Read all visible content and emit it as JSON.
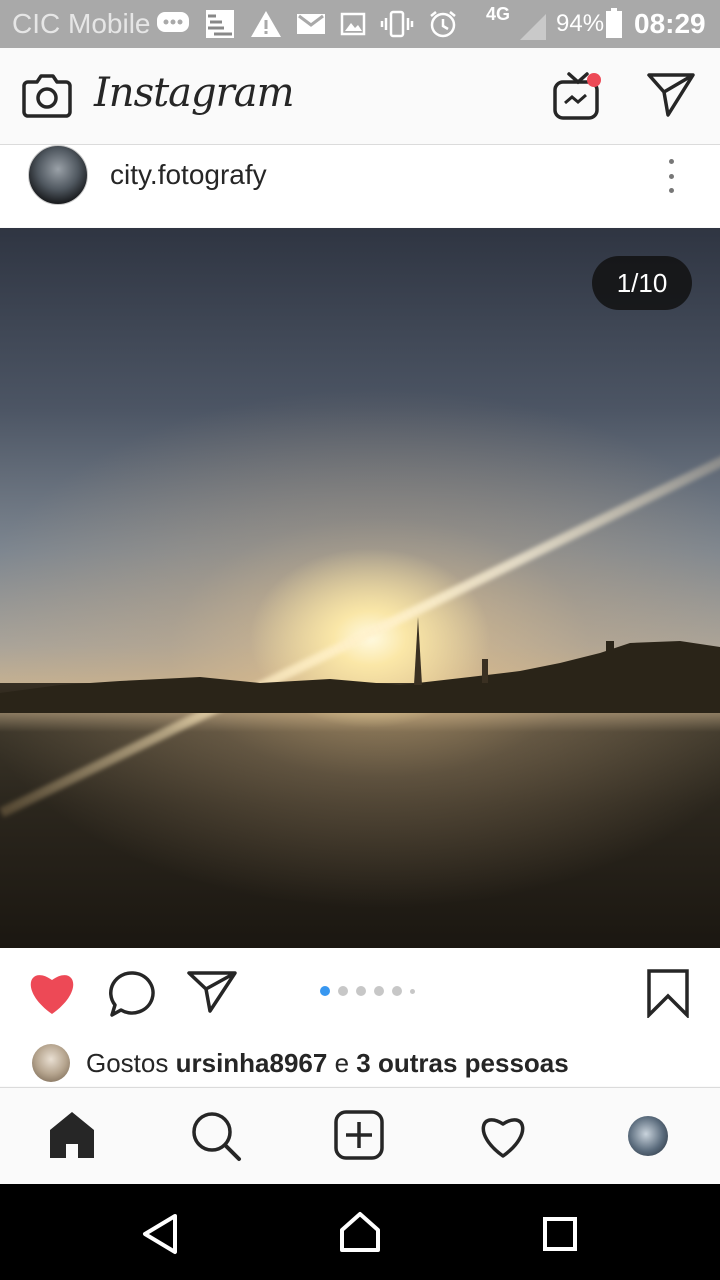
{
  "status_bar": {
    "carrier": "CIC Mobile",
    "network": "4G",
    "battery_percent": "94%",
    "time": "08:29",
    "icons": [
      "chat-icon",
      "image-icon",
      "warning-icon",
      "gmail-icon",
      "gallery-icon",
      "vibrate-icon",
      "alarm-icon",
      "signal-icon",
      "battery-icon"
    ]
  },
  "header": {
    "app_name": "Instagram",
    "icons": [
      "camera-icon",
      "igtv-icon",
      "direct-icon"
    ],
    "notification_color": "#ed4956"
  },
  "post": {
    "username": "city.fotografy",
    "photo_counter": "1/10",
    "carousel_dots": 6,
    "carousel_active_index": 0,
    "liked": true,
    "like_color": "#ed4956",
    "accent_color": "#3897f0"
  },
  "likes": {
    "prefix": "Gostos",
    "user": "ursinha8967",
    "conjunction": "e",
    "others": "3 outras pessoas"
  },
  "bottom_nav": {
    "items": [
      "home-icon",
      "search-icon",
      "add-icon",
      "activity-icon",
      "profile-avatar"
    ],
    "active": "home"
  },
  "system_nav": {
    "items": [
      "back-icon",
      "home-icon",
      "recents-icon"
    ]
  }
}
